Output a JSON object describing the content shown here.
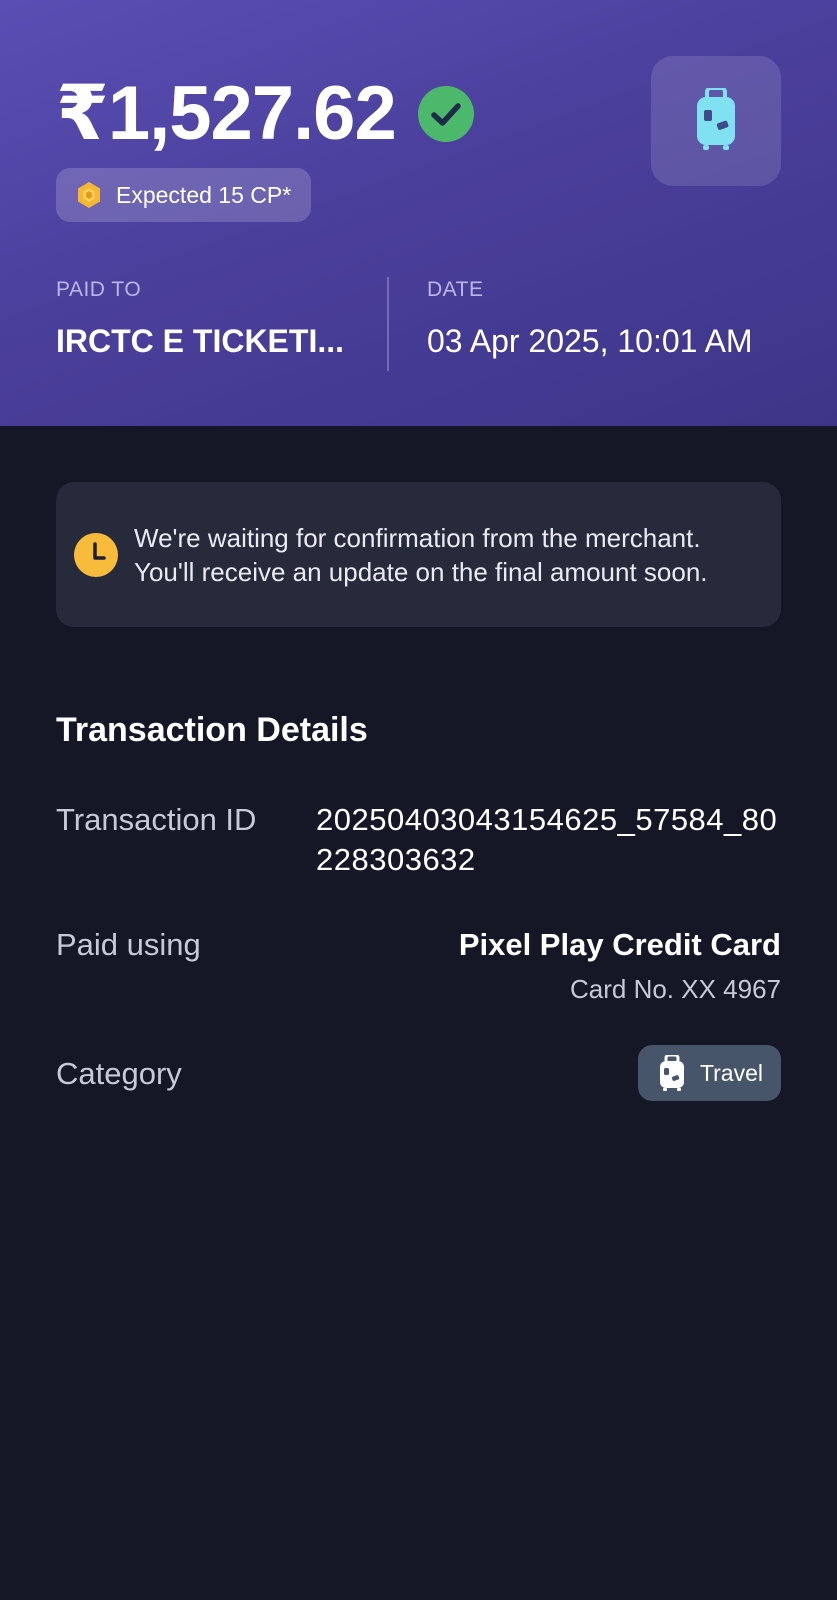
{
  "header": {
    "amount": "₹1,527.62",
    "status_icon": "check-circle-icon",
    "rewards_label": "Expected 15 CP*",
    "rewards_icon": "coin-icon",
    "category_icon": "suitcase-icon",
    "paid_to_label": "PAID TO",
    "paid_to_value": "IRCTC E TICKETI...",
    "date_label": "DATE",
    "date_value": "03 Apr 2025, 10:01 AM"
  },
  "notice": {
    "icon": "clock-icon",
    "text": "We're waiting for confirmation from the merchant. You'll receive an update on the final amount soon."
  },
  "details": {
    "title": "Transaction Details",
    "transaction_id_label": "Transaction ID",
    "transaction_id_value": "20250403043154625_57584_80228303632",
    "paid_using_label": "Paid using",
    "paid_using_value": "Pixel Play Credit Card",
    "card_number": "Card No. XX 4967",
    "category_label": "Category",
    "category_value": "Travel",
    "category_icon": "suitcase-icon"
  },
  "colors": {
    "hero_gradient_start": "#5a4eb4",
    "hero_gradient_end": "#3e3588",
    "background": "#151727",
    "verified_green": "#4cb86b",
    "coin_yellow": "#f6b733",
    "clock_yellow": "#f9bb3b",
    "suitcase_cyan": "#7fe1f2",
    "notice_bg": "#272a3a",
    "chip_bg": "#47556a"
  }
}
